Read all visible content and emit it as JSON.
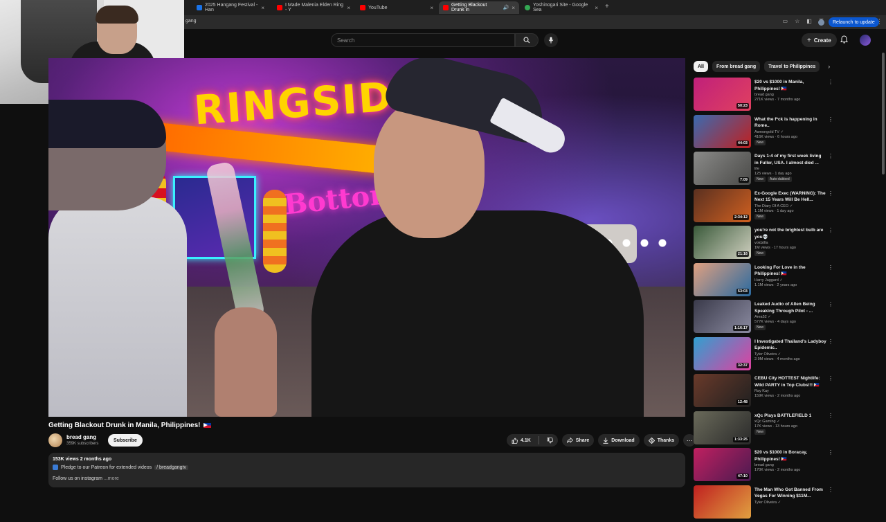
{
  "browser": {
    "tabs": [
      {
        "label": "2025 Hangang Festival - Han",
        "color": "#1a73e8"
      },
      {
        "label": "I Made Malenia Elden Ring - Y",
        "color": "#ff0000"
      },
      {
        "label": "YouTube",
        "color": "#ff0000"
      },
      {
        "label": "Getting Blackout Drunk in",
        "color": "#ff0000"
      },
      {
        "label": "Yoshinogari Site - Google Sea",
        "color": "#34a853"
      }
    ],
    "new_tab": "+",
    "address_partial": "gang",
    "relaunch_label": "Relaunch to update"
  },
  "header": {
    "search_placeholder": "Search",
    "create_label": "Create",
    "create_plus": "+"
  },
  "video": {
    "title": "Getting Blackout Drunk in Manila, Philippines!",
    "sign_text": "RINGSIDE",
    "neon_text": "Bottom"
  },
  "channel": {
    "name": "bread gang",
    "subscribers": "359K subscribers",
    "subscribe_label": "Subscribe"
  },
  "actions": {
    "likes": "4.1K",
    "share": "Share",
    "download": "Download",
    "thanks": "Thanks",
    "more": "⋯"
  },
  "description": {
    "meta": "153K views  2 months ago",
    "patreon": "Pledge to our Patreon for extended videos",
    "patreon_link": "/ breadgangtv",
    "follow": "Follow us on instagram",
    "more": "...more"
  },
  "chips": [
    {
      "label": "All",
      "active": true
    },
    {
      "label": "From bread gang",
      "active": false
    },
    {
      "label": "Travel to Philippines",
      "active": false
    }
  ],
  "chip_next": "›",
  "recommendations": [
    {
      "title": "$20 vs $1000 in Manila, Philippines! 🇵🇭",
      "channel": "bread gang",
      "views": "271K views · 7 months ago",
      "duration": "50:23",
      "badges": [],
      "thumb": [
        "#c0207a",
        "#e04060"
      ]
    },
    {
      "title": "What the f*ck is happening in Rome..",
      "channel": "Asmongold TV ✓",
      "views": "416K views · 6 hours ago",
      "duration": "44:03",
      "badges": [
        "New"
      ],
      "thumb": [
        "#3a6ab0",
        "#c02020"
      ]
    },
    {
      "title": "Days 1-4 of my first week living in Fuller, USA. I almost died ...",
      "channel": "life",
      "views": "125 views · 1 day ago",
      "duration": "7:09",
      "badges": [
        "New",
        "Auto-dubbed"
      ],
      "thumb": [
        "#8a8a88",
        "#4a4a48"
      ]
    },
    {
      "title": "Ex-Google Exec (WARNING): The Next 15 Years Will Be Hell...",
      "channel": "The Diary Of A CEO ✓",
      "views": "1.1M views · 1 day ago",
      "duration": "2:34:12",
      "badges": [
        "New"
      ],
      "thumb": [
        "#5a3020",
        "#d06020"
      ]
    },
    {
      "title": "you're not the brightest bulb are you💀",
      "channel": "voidzilla",
      "views": "1M views · 17 hours ago",
      "duration": "21:16",
      "badges": [
        "New"
      ],
      "thumb": [
        "#3a5a3a",
        "#d0d0c0"
      ]
    },
    {
      "title": "Looking For Love in the Philippines! 🇵🇭",
      "channel": "Harry Jaggard ✓",
      "views": "1.1M views · 2 years ago",
      "duration": "53:03",
      "badges": [],
      "thumb": [
        "#e0a080",
        "#2a6aa0"
      ]
    },
    {
      "title": "Leaked Audio of Allen Being Speaking Through Pilot - ...",
      "channel": "Area52 ✓",
      "views": "577K views · 4 days ago",
      "duration": "1:16:17",
      "badges": [
        "New"
      ],
      "thumb": [
        "#3a3a4a",
        "#8a8aa0"
      ]
    },
    {
      "title": "I Investigated Thailand's Ladyboy Epidemic..",
      "channel": "Tyler Oliveira ✓",
      "views": "2.9M views · 4 months ago",
      "duration": "32:37",
      "badges": [],
      "thumb": [
        "#30a0d0",
        "#e040a0"
      ]
    },
    {
      "title": "CEBU City HOTTEST Nightlife: Wild PARTY in Top Clubs!!! 🇵🇭",
      "channel": "Ray Kay",
      "views": "159K views · 2 months ago",
      "duration": "12:48",
      "badges": [],
      "thumb": [
        "#6a3a2a",
        "#202020"
      ]
    },
    {
      "title": "xQc Plays BATTLEFIELD 1",
      "channel": "xQc Gaming ✓",
      "views": "17K views · 13 hours ago",
      "duration": "1:33:25",
      "badges": [
        "New"
      ],
      "thumb": [
        "#6a6a5a",
        "#2a2a2a"
      ]
    },
    {
      "title": "$20 vs $1000 in Boracay, Philippines! 🇵🇭",
      "channel": "bread gang",
      "views": "170K views · 2 months ago",
      "duration": "47:10",
      "badges": [],
      "thumb": [
        "#c02060",
        "#4a1a50"
      ]
    },
    {
      "title": "The Man Who Got Banned From Vegas For Winning $11M...",
      "channel": "Tyler Oliveira ✓",
      "views": "",
      "duration": "",
      "badges": [],
      "thumb": [
        "#c02020",
        "#e0a040"
      ]
    }
  ]
}
